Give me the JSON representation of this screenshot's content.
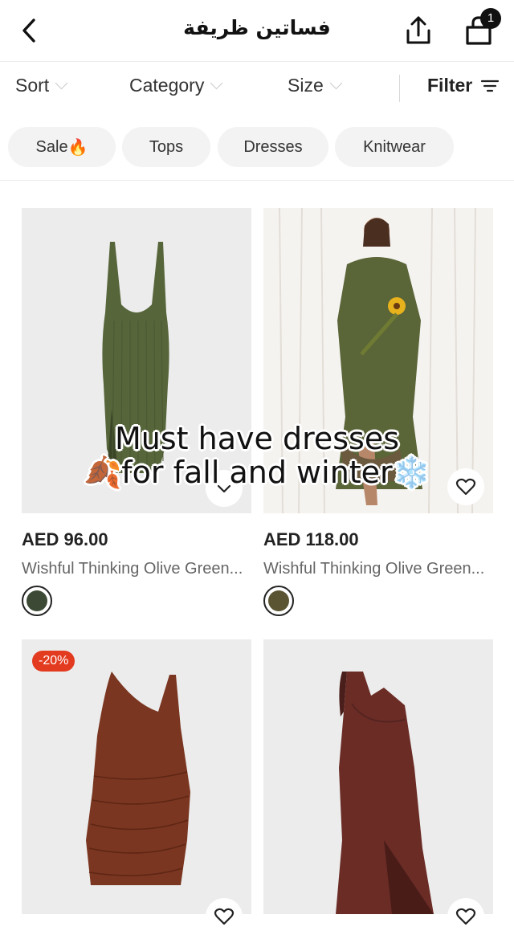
{
  "header": {
    "title": "فساتين ظريفة",
    "cart_count": "1"
  },
  "filterbar": {
    "sort": "Sort",
    "category": "Category",
    "size": "Size",
    "filter": "Filter"
  },
  "chips": [
    {
      "label": "Sale",
      "emoji": "🔥"
    },
    {
      "label": "Tops"
    },
    {
      "label": "Dresses"
    },
    {
      "label": "Knitwear"
    }
  ],
  "products": [
    {
      "price": "AED 96.00",
      "name": "Wishful Thinking Olive Green...",
      "swatch": "#3c4a35"
    },
    {
      "price": "AED 118.00",
      "name": "Wishful Thinking Olive Green...",
      "swatch": "#5a5432"
    },
    {
      "discount": "-20%"
    },
    {}
  ],
  "overlay": {
    "line1": "Must have dresses",
    "line2": "for fall and winter",
    "emoji_left": "🍂",
    "emoji_right": "❄️"
  },
  "colors": {
    "olive": "#5c6a3e",
    "rust": "#7a3620",
    "badge": "#e33b1f"
  }
}
